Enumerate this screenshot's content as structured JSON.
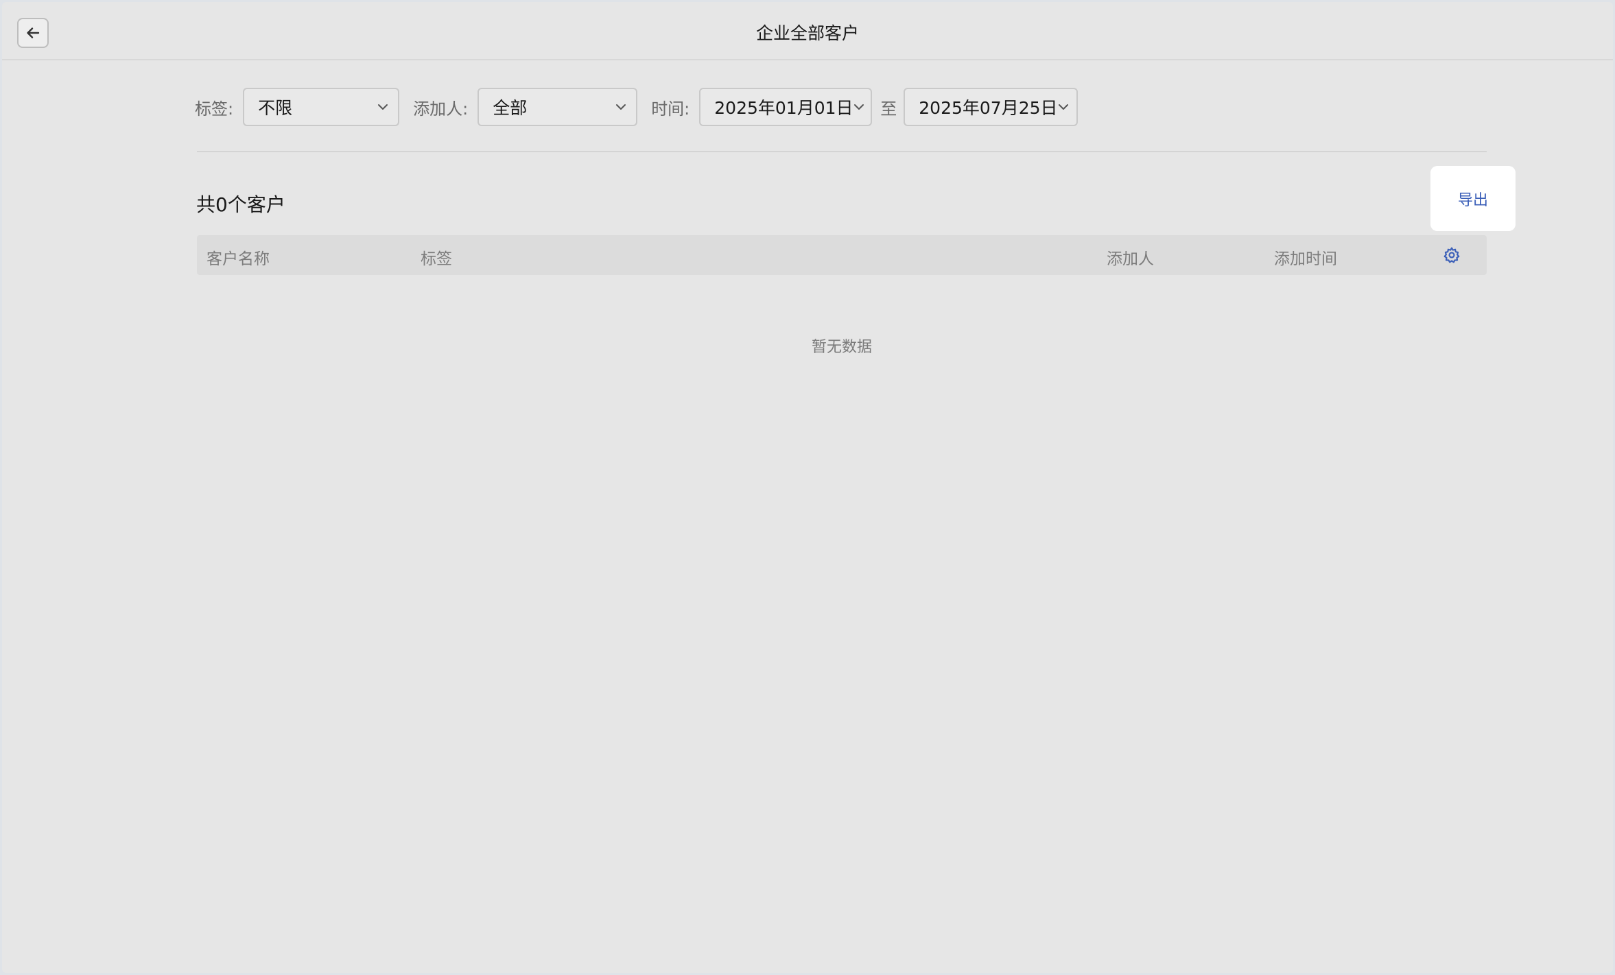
{
  "window": {
    "title": "企业全部客户"
  },
  "filters": {
    "tag_label": "标签:",
    "tag_value": "不限",
    "adder_label": "添加人:",
    "adder_value": "全部",
    "time_label": "时间:",
    "start_date": "2025年01月01日",
    "range_sep": "至",
    "end_date": "2025年07月25日"
  },
  "summary": {
    "count_text": "共0个客户"
  },
  "actions": {
    "export_label": "导出"
  },
  "table": {
    "columns": [
      "客户名称",
      "标签",
      "添加人",
      "添加时间"
    ],
    "rows": [],
    "empty_text": "暂无数据"
  },
  "colors": {
    "accent": "#3b5fb8",
    "background": "#e6e6e6",
    "header_bg": "#dcdcdc"
  },
  "icons": {
    "back": "arrow-left-icon",
    "dropdown": "chevron-down-icon",
    "settings": "gear-icon"
  }
}
